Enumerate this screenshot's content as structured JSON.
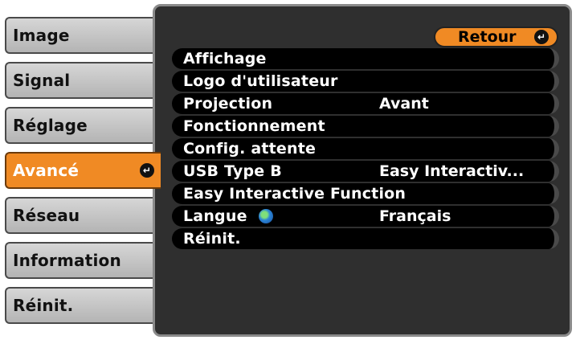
{
  "sidebar": {
    "tabs": [
      {
        "label": "Image"
      },
      {
        "label": "Signal"
      },
      {
        "label": "Réglage"
      },
      {
        "label": "Avancé",
        "active": true
      },
      {
        "label": "Réseau"
      },
      {
        "label": "Information"
      },
      {
        "label": "Réinit."
      }
    ]
  },
  "panel": {
    "retour_label": "Retour",
    "items": [
      {
        "label": "Affichage",
        "value": ""
      },
      {
        "label": "Logo d'utilisateur",
        "value": ""
      },
      {
        "label": "Projection",
        "value": "Avant"
      },
      {
        "label": "Fonctionnement",
        "value": ""
      },
      {
        "label": "Config. attente",
        "value": ""
      },
      {
        "label": "USB Type B",
        "value": "Easy Interactiv..."
      },
      {
        "label": "Easy Interactive Function",
        "value": ""
      },
      {
        "label": "Langue",
        "value": "Français",
        "icon": "globe-icon"
      },
      {
        "label": "Réinit.",
        "value": ""
      }
    ]
  },
  "colors": {
    "accent": "#f08a24",
    "panel_bg": "#2f2f2f",
    "tab_bg": "#c8c8c8",
    "row_bg": "#000000"
  }
}
